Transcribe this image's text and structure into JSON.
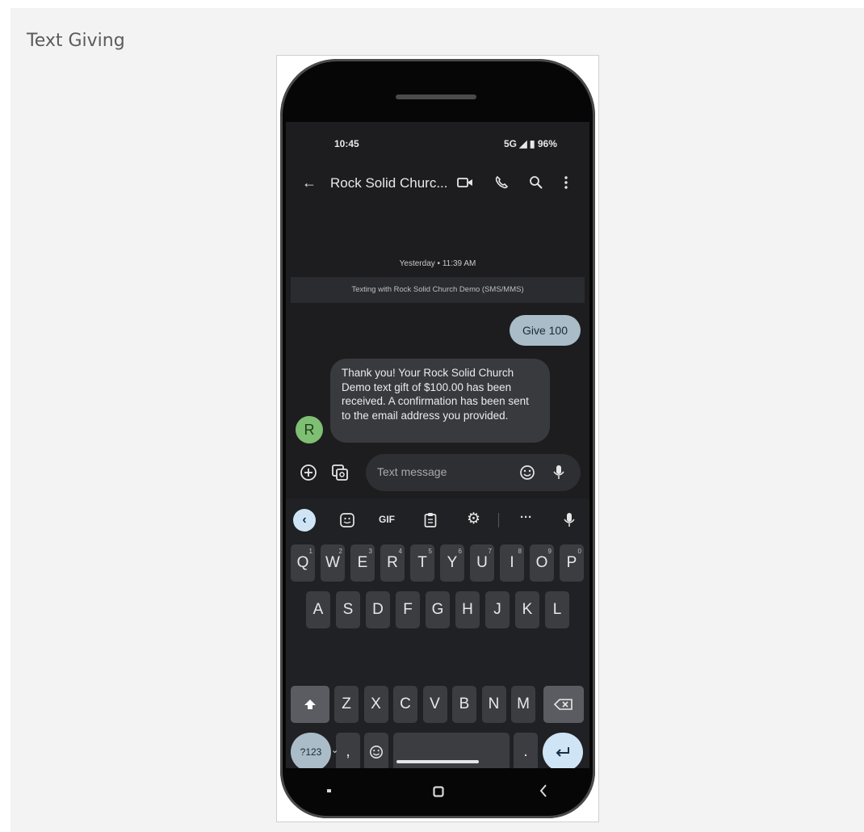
{
  "page": {
    "title": "Text Giving"
  },
  "status_bar": {
    "time": "10:45",
    "indicators": "5G ◢ ▮ 96%"
  },
  "app_bar": {
    "back_icon": "arrow-left-icon",
    "title": "Rock Solid Churc...",
    "actions": [
      "video-call-icon",
      "phone-icon",
      "search-icon",
      "more-vert-icon"
    ]
  },
  "conversation": {
    "date_label": "Yesterday • 11:39 AM",
    "info_banner": "Texting with Rock Solid Church Demo (SMS/MMS)",
    "messages": [
      {
        "direction": "sent",
        "text": "Give 100"
      },
      {
        "direction": "received",
        "sender_initial": "R",
        "text": "Thank you! Your Rock Solid Church Demo text gift of $100.00 has been received. A confirmation has been sent to the email address you provided."
      }
    ]
  },
  "composer": {
    "placeholder": "Text message"
  },
  "keyboard": {
    "toolbar": {
      "gif_label": "GIF",
      "more_label": "···"
    },
    "row1": [
      {
        "letter": "Q",
        "hint": "1"
      },
      {
        "letter": "W",
        "hint": "2"
      },
      {
        "letter": "E",
        "hint": "3"
      },
      {
        "letter": "R",
        "hint": "4"
      },
      {
        "letter": "T",
        "hint": "5"
      },
      {
        "letter": "Y",
        "hint": "6"
      },
      {
        "letter": "U",
        "hint": "7"
      },
      {
        "letter": "I",
        "hint": "8"
      },
      {
        "letter": "O",
        "hint": "9"
      },
      {
        "letter": "P",
        "hint": "0"
      }
    ],
    "row2": [
      "A",
      "S",
      "D",
      "F",
      "G",
      "H",
      "J",
      "K",
      "L"
    ],
    "row3": [
      "Z",
      "X",
      "C",
      "V",
      "B",
      "N",
      "M"
    ],
    "symbols_label": "?123",
    "comma_label": ",",
    "period_label": "."
  },
  "colors": {
    "sent_bubble": "#a9bcc8",
    "received_bubble": "#393a3e",
    "avatar": "#7fbf73",
    "enter_key": "#cfe5f5"
  }
}
